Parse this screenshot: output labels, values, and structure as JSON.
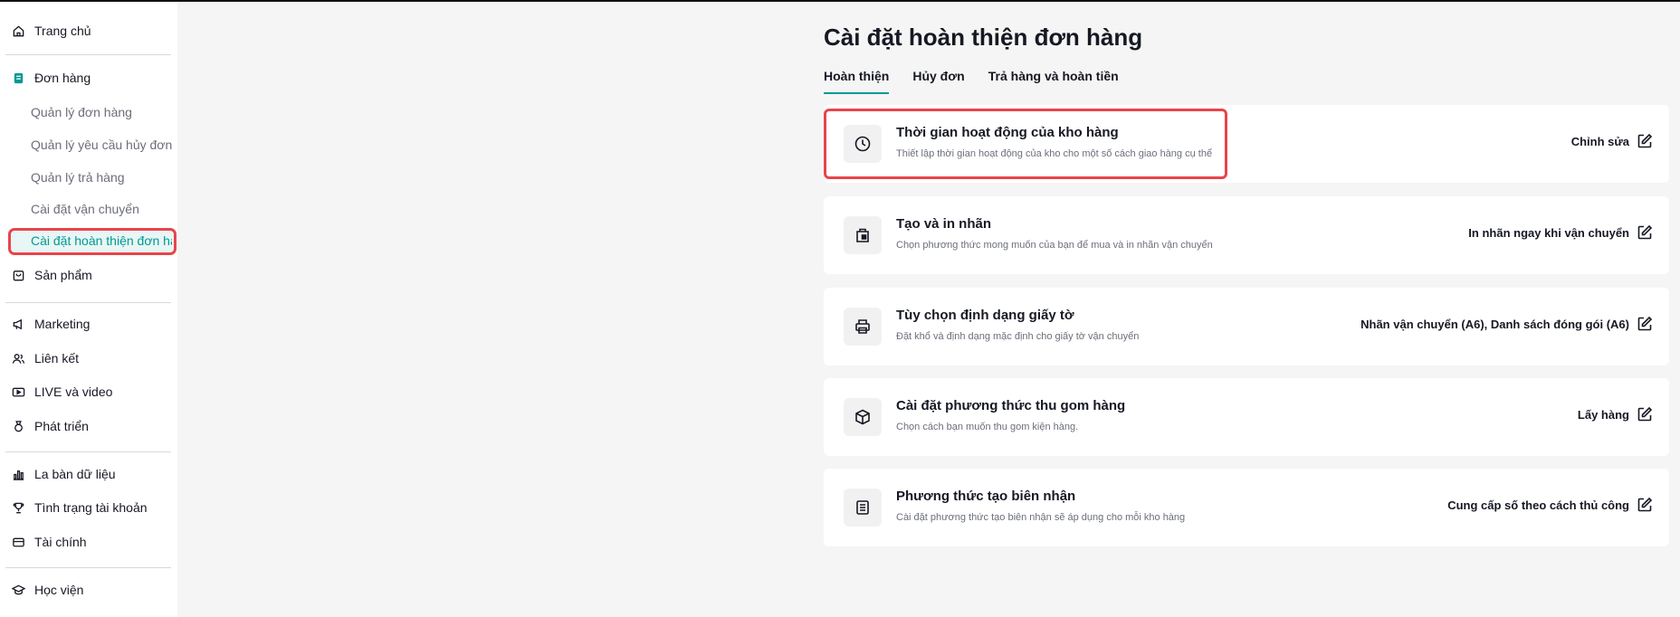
{
  "sidebar": {
    "home": "Trang chủ",
    "orders": "Đơn hàng",
    "order_sub": [
      "Quản lý đơn hàng",
      "Quản lý yêu cầu hủy đơn",
      "Quản lý trả hàng",
      "Cài đặt vận chuyển",
      "Cài đặt hoàn thiện đơn hà.."
    ],
    "products": "Sản phẩm",
    "marketing": "Marketing",
    "affiliate": "Liên kết",
    "live": "LIVE và video",
    "growth": "Phát triển",
    "compass": "La bàn dữ liệu",
    "account_health": "Tình trạng tài khoản",
    "finance": "Tài chính",
    "academy": "Học viện"
  },
  "page": {
    "title": "Cài đặt hoàn thiện đơn hàng",
    "tabs": [
      "Hoàn thiện",
      "Hủy đơn",
      "Trả hàng và hoàn tiền"
    ]
  },
  "cards": [
    {
      "title": "Thời gian hoạt động của kho hàng",
      "desc": "Thiết lập thời gian hoạt động của kho cho một số cách giao hàng cụ thể",
      "action": "Chỉnh sửa",
      "icon": "clock-icon"
    },
    {
      "title": "Tạo và in nhãn",
      "desc": "Chọn phương thức mong muốn của bạn để mua và in nhãn vận chuyển",
      "action": "In nhãn ngay khi vận chuyển",
      "icon": "label-icon"
    },
    {
      "title": "Tùy chọn định dạng giấy tờ",
      "desc": "Đặt khổ và định dạng mặc định cho giấy tờ vận chuyển",
      "action": "Nhãn vận chuyển (A6), Danh sách đóng gói (A6)",
      "icon": "printer-icon"
    },
    {
      "title": "Cài đặt phương thức thu gom hàng",
      "desc": "Chọn cách bạn muốn thu gom kiện hàng.",
      "action": "Lấy hàng",
      "icon": "package-icon"
    },
    {
      "title": "Phương thức tạo biên nhận",
      "desc": "Cài đặt phương thức tạo biên nhận sẽ áp dụng cho mỗi kho hàng",
      "action": "Cung cấp số theo cách thủ công",
      "icon": "receipt-icon"
    }
  ],
  "colors": {
    "accent": "#009995",
    "highlight": "#e9444b"
  }
}
